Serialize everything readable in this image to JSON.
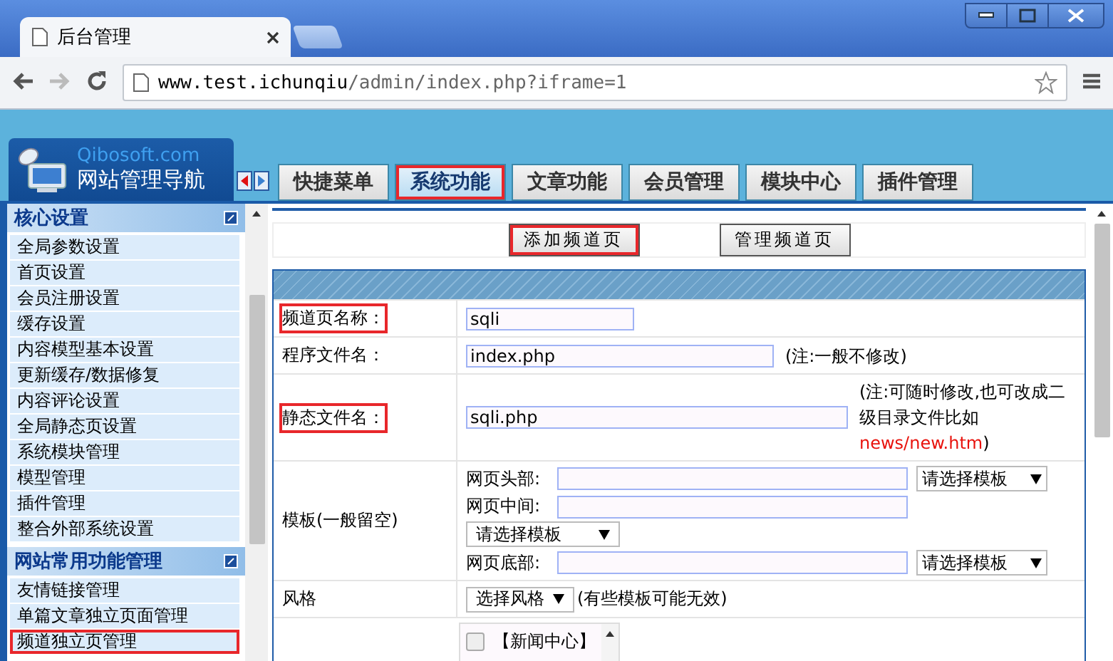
{
  "browser": {
    "tab_title": "后台管理",
    "url_host": "www.test.ichunqiu",
    "url_path": "/admin/index.php?iframe=1"
  },
  "logo": {
    "brand": "Qibosoft.com",
    "title": "网站管理导航"
  },
  "nav_tabs": [
    {
      "label": "快捷菜单",
      "selected": false,
      "highlighted": false
    },
    {
      "label": "系统功能",
      "selected": true,
      "highlighted": true
    },
    {
      "label": "文章功能",
      "selected": false,
      "highlighted": false
    },
    {
      "label": "会员管理",
      "selected": false,
      "highlighted": false
    },
    {
      "label": "模块中心",
      "selected": false,
      "highlighted": false
    },
    {
      "label": "插件管理",
      "selected": false,
      "highlighted": false
    }
  ],
  "sidebar": {
    "sections": [
      {
        "title": "核心设置",
        "items": [
          {
            "label": "全局参数设置",
            "highlighted": false
          },
          {
            "label": "首页设置",
            "highlighted": false
          },
          {
            "label": "会员注册设置",
            "highlighted": false
          },
          {
            "label": "缓存设置",
            "highlighted": false
          },
          {
            "label": "内容模型基本设置",
            "highlighted": false
          },
          {
            "label": "更新缓存/数据修复",
            "highlighted": false
          },
          {
            "label": "内容评论设置",
            "highlighted": false
          },
          {
            "label": "全局静态页设置",
            "highlighted": false
          },
          {
            "label": "系统模块管理",
            "highlighted": false
          },
          {
            "label": "模型管理",
            "highlighted": false
          },
          {
            "label": "插件管理",
            "highlighted": false
          },
          {
            "label": "整合外部系统设置",
            "highlighted": false
          }
        ]
      },
      {
        "title": "网站常用功能管理",
        "items": [
          {
            "label": "友情链接管理",
            "highlighted": false
          },
          {
            "label": "单篇文章独立页面管理",
            "highlighted": false
          },
          {
            "label": "频道独立页管理",
            "highlighted": true
          }
        ]
      }
    ]
  },
  "actions": [
    {
      "label": "添加频道页",
      "highlighted": true
    },
    {
      "label": "管理频道页",
      "highlighted": false
    }
  ],
  "form": {
    "rows": [
      {
        "kind": "text",
        "label": "频道页名称：",
        "highlighted": true,
        "value": "sqli"
      },
      {
        "kind": "text",
        "label": "程序文件名：",
        "highlighted": false,
        "value": "index.php",
        "note_parts": [
          {
            "kind": "plain",
            "text": "(注:一般不修改)"
          }
        ]
      },
      {
        "kind": "text",
        "label": "静态文件名：",
        "highlighted": true,
        "value": "sqli.php",
        "note_parts": [
          {
            "kind": "plain",
            "text": "(注:可随时修改,也可改成二级目录文件比如"
          },
          {
            "kind": "red",
            "text": "news/new.htm"
          },
          {
            "kind": "plain",
            "text": ")"
          }
        ]
      },
      {
        "kind": "template",
        "label": "模板(一般留空)",
        "highlighted": false,
        "items": [
          {
            "kind": "field",
            "label": "网页头部:",
            "select": "请选择模板"
          },
          {
            "kind": "field",
            "label": "网页中间:"
          },
          {
            "kind": "select",
            "select": "请选择模板"
          },
          {
            "kind": "field",
            "label": "网页底部:",
            "select": "请选择模板"
          }
        ]
      },
      {
        "kind": "style",
        "label": "风格",
        "highlighted": false,
        "select": "选择风格",
        "note": "(有些模板可能无效)"
      },
      {
        "kind": "checklist",
        "items": [
          {
            "label": "【新闻中心】",
            "checked": false
          }
        ]
      }
    ]
  }
}
